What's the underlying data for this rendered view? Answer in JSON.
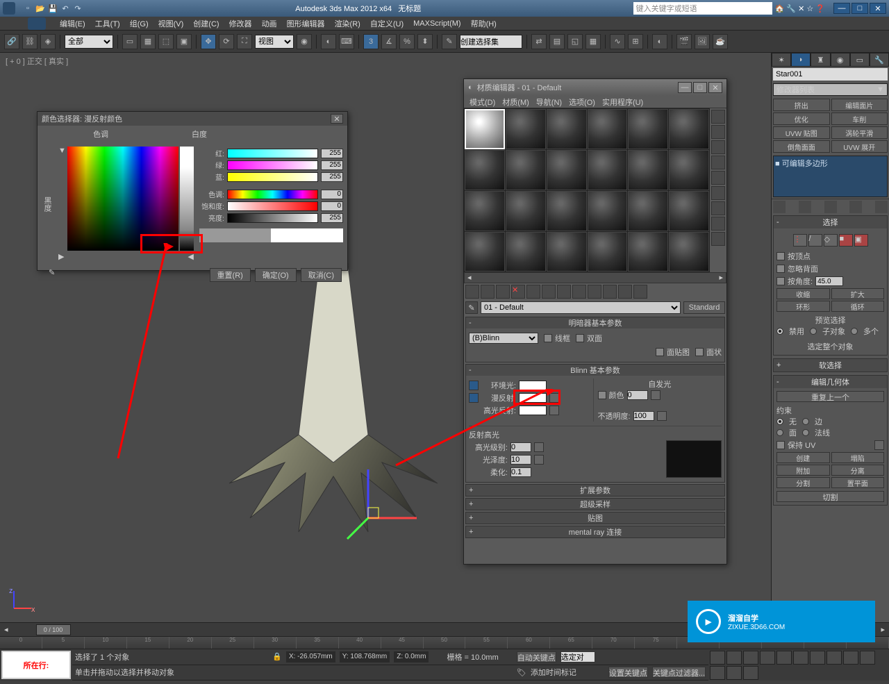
{
  "titlebar": {
    "app": "Autodesk 3ds Max  2012 x64",
    "doc": "无标题",
    "search_placeholder": "键入关键字或短语"
  },
  "menu": [
    "编辑(E)",
    "工具(T)",
    "组(G)",
    "视图(V)",
    "创建(C)",
    "修改器",
    "动画",
    "图形编辑器",
    "渲染(R)",
    "自定义(U)",
    "MAXScript(M)",
    "帮助(H)"
  ],
  "toolbar": {
    "filter": "全部",
    "view": "视图",
    "named_sel": "创建选择集"
  },
  "viewport": {
    "label": "[ + 0 ] 正交 [ 真实 ]"
  },
  "cmdpanel": {
    "obj": "Star001",
    "modlist": "修改器列表",
    "btns": [
      "挤出",
      "编辑面片",
      "优化",
      "车削",
      "UVW 贴图",
      "涡轮平滑",
      "倒角面面",
      "UVW 展开"
    ],
    "stack": "■ 可编辑多边形",
    "select_hdr": "选择",
    "byvertex": "按顶点",
    "ignoreback": "忽略背面",
    "byangle": "按角度:",
    "angle": "45.0",
    "shrink": "收缩",
    "grow": "扩大",
    "ring": "环形",
    "loop": "循环",
    "preview": "预览选择",
    "p_off": "禁用",
    "p_sub": "子对象",
    "p_multi": "多个",
    "selall": "选定整个对象",
    "softsel_hdr": "软选择",
    "editgeom_hdr": "编辑几何体",
    "repeatlast": "重复上一个",
    "constraints": "约束",
    "c_none": "无",
    "c_edge": "边",
    "c_face": "面",
    "c_normal": "法线",
    "preserveuv": "保持 UV",
    "create": "创建",
    "collapse": "塌陷",
    "attach": "附加",
    "detach": "分离",
    "slice": "分割",
    "slicepl": "置平面",
    "cut": "切割"
  },
  "mateditor": {
    "title": "材质编辑器 - 01 - Default",
    "menu": [
      "模式(D)",
      "材质(M)",
      "导航(N)",
      "选项(O)",
      "实用程序(U)"
    ],
    "name": "01 - Default",
    "type": "Standard",
    "shader_hdr": "明暗器基本参数",
    "shader": "(B)Blinn",
    "wire": "线框",
    "two": "双面",
    "facemap": "面贴图",
    "faceted": "面状",
    "blinn_hdr": "Blinn 基本参数",
    "selfillum": "自发光",
    "ambient": "环境光:",
    "diffuse": "漫反射:",
    "specular": "高光反射:",
    "color_lbl": "颜色",
    "color_v": "0",
    "opacity": "不透明度:",
    "opacity_v": "100",
    "spechi": "反射高光",
    "speclvl": "高光级别:",
    "spec_v": "0",
    "gloss": "光泽度:",
    "gloss_v": "10",
    "soften": "柔化:",
    "soften_v": "0.1",
    "ext": "扩展参数",
    "super": "超级采样",
    "maps": "贴图",
    "mr": "mental ray 连接"
  },
  "colorpicker": {
    "title": "颜色选择器: 漫反射颜色",
    "hue": "色调",
    "whiteness": "白度",
    "black_lbl": "黑度",
    "r": "红:",
    "g": "绿:",
    "b": "蓝:",
    "h": "色调:",
    "s": "饱和度:",
    "v": "亮度:",
    "rv": "255",
    "gv": "255",
    "bv": "255",
    "hv": "0",
    "sv": "0",
    "vv": "255",
    "reset": "重置(R)",
    "ok": "确定(O)",
    "cancel": "取消(C)"
  },
  "timeline": {
    "pos": "0 / 100"
  },
  "status": {
    "tag": "所在行:",
    "sel": "选择了 1 个对象",
    "hint": "单击并拖动以选择并移动对象",
    "x": "X: -26.057mm",
    "y": "Y: 108.768mm",
    "z": "Z: 0.0mm",
    "grid": "栅格 = 10.0mm",
    "autokey": "自动关键点",
    "selfilt": "选定对",
    "setkey": "设置关键点",
    "keyfilt": "关键点过滤器...",
    "addtime": "添加时间标记"
  },
  "watermark": {
    "brand": "溜溜自学",
    "url": "ZIXUE.3D66.COM"
  }
}
